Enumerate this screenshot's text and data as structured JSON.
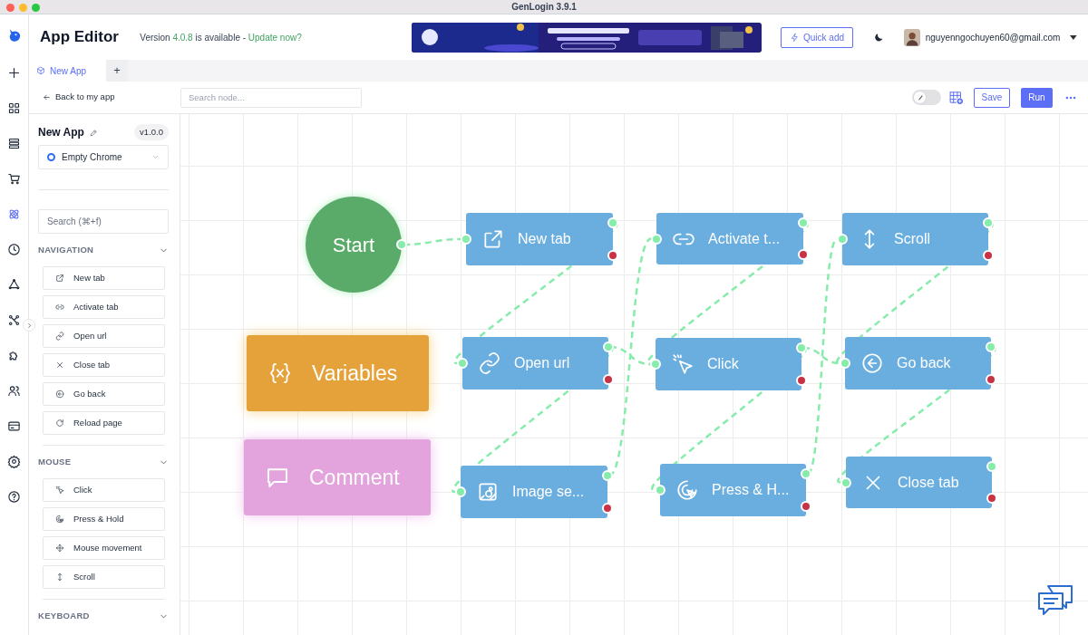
{
  "window": {
    "title": "GenLogin 3.9.1"
  },
  "nav_rail": [
    {
      "selected": false
    },
    {
      "selected": false
    },
    {
      "selected": false
    },
    {
      "selected": false
    },
    {
      "selected": true
    },
    {
      "selected": false
    },
    {
      "selected": false
    },
    {
      "selected": false
    },
    {
      "selected": false
    },
    {
      "selected": false
    },
    {
      "selected": false
    },
    {
      "selected": false
    },
    {
      "selected": false
    }
  ],
  "header": {
    "title": "App Editor",
    "version_notice": {
      "prefix": "Version ",
      "version": "4.0.8",
      "suffix": " is available - ",
      "link": "Update now?"
    },
    "quick_add": "Quick add",
    "account": "nguyenngochuyen60@gmail.com"
  },
  "tabs": [
    {
      "label": "New App",
      "selected": true
    }
  ],
  "new_tab": "+",
  "toolbar": {
    "back": "Back to my app",
    "search": {
      "placeholder": "Search node..."
    },
    "toggle": {
      "on": false
    },
    "save": "Save",
    "run": "Run"
  },
  "sidebar": {
    "app_name": "New App",
    "version": "v1.0.0",
    "browser": "Empty Chrome",
    "search": {
      "placeholder": "Search (⌘+f)"
    },
    "sections": [
      {
        "title": "NAVIGATION",
        "expanded": true,
        "items": [
          "New tab",
          "Activate tab",
          "Open url",
          "Close tab",
          "Go back",
          "Reload page"
        ]
      },
      {
        "title": "MOUSE",
        "expanded": true,
        "items": [
          "Click",
          "Press & Hold",
          "Mouse movement",
          "Scroll"
        ]
      },
      {
        "title": "KEYBOARD",
        "expanded": true
      }
    ]
  },
  "canvas": {
    "nodes": [
      {
        "kind": "start",
        "label": "Start"
      },
      {
        "kind": "action",
        "label": "New tab"
      },
      {
        "kind": "action",
        "label": "Activate t..."
      },
      {
        "kind": "action",
        "label": "Scroll"
      },
      {
        "kind": "variables",
        "label": "Variables"
      },
      {
        "kind": "action",
        "label": "Open url"
      },
      {
        "kind": "action",
        "label": "Click"
      },
      {
        "kind": "action",
        "label": "Go back"
      },
      {
        "kind": "comment",
        "label": "Comment"
      },
      {
        "kind": "action",
        "label": "Image se..."
      },
      {
        "kind": "action",
        "label": "Press & H..."
      },
      {
        "kind": "action",
        "label": "Close tab"
      }
    ]
  }
}
